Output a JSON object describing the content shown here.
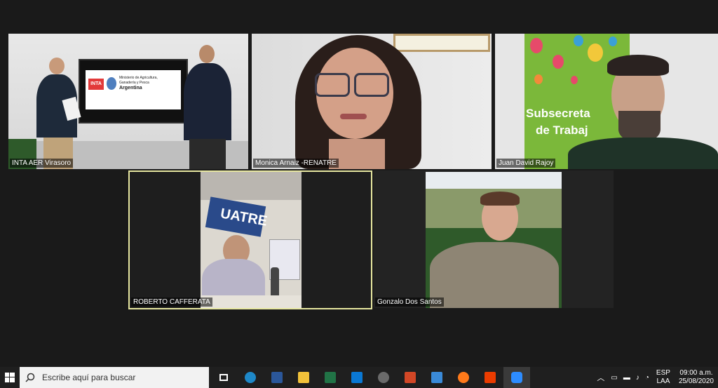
{
  "participants": [
    {
      "name": "INTA AER Virasoro",
      "sign": {
        "line1": "Ministerio de Agricultura,",
        "line2": "Ganadería y Pesca",
        "line3": "Argentina",
        "logo": "INTA"
      }
    },
    {
      "name": "Monica Arnaiz -RENATRE"
    },
    {
      "name": "Juan David Rajoy",
      "banner": {
        "line1": "Subsecreta",
        "line2": "de Trabaj"
      }
    },
    {
      "name": "ROBERTO CAFFERATA",
      "sign": "UATRE",
      "active": true
    },
    {
      "name": "Gonzalo Dos Santos"
    }
  ],
  "colors": {
    "active_border": "#e6e6a0",
    "banner_green": "#7bb83a"
  },
  "taskbar": {
    "search_placeholder": "Escribe aquí para buscar",
    "apps": [
      "task-view-icon",
      "edge-icon",
      "word-icon",
      "file-explorer-icon",
      "excel-icon",
      "mail-icon",
      "camera-icon",
      "powerpoint-icon",
      "photos-icon",
      "firefox-icon",
      "office-icon",
      "zoom-icon"
    ],
    "lang": "ESP",
    "layout": "LAA",
    "time": "09:00 a.m.",
    "date": "25/08/2020"
  }
}
